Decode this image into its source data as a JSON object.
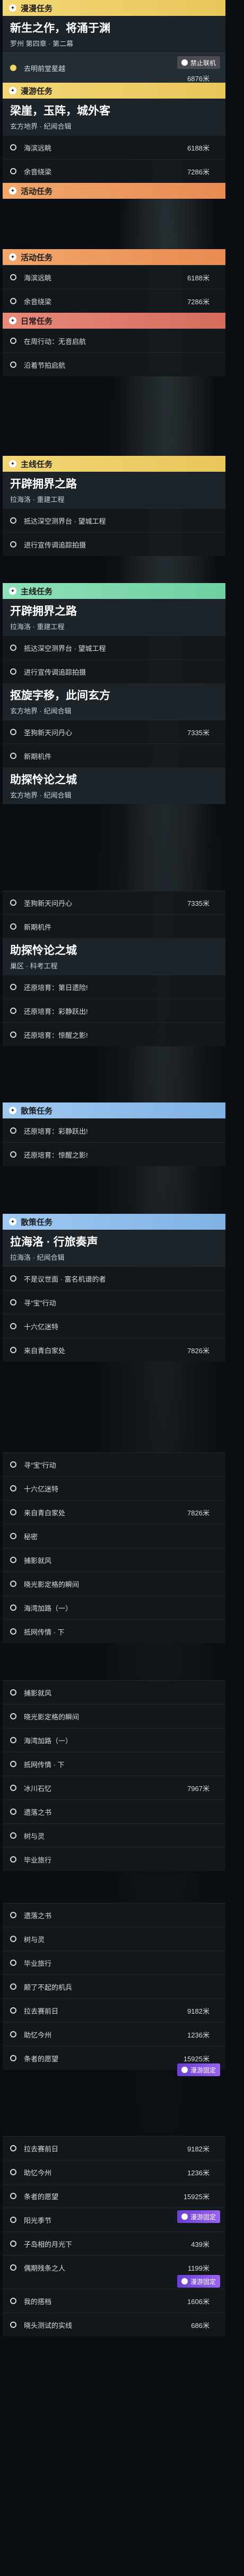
{
  "labels": {
    "cat_permanent": "漫漫任务",
    "cat_seasonal": "漫游任务",
    "cat_active": "活动任务",
    "cat_side": "日常任务",
    "cat_main": "主线任务",
    "cat_trail": "散策任务"
  },
  "quests": {
    "q1_title": "新生之作，将涌于渊",
    "q1_sub": "罗州 第四章 · 第二幕",
    "q2_title": "梁崖，玉阵，城外客",
    "q2_sub": "玄方地界 · 纪闻合辑",
    "q3_title": "开辟拥界之路",
    "q3_sub": "拉海洛 · 重建工程",
    "q4_title": "抠旋字移，此间玄方",
    "q4_sub": "玄方地界 · 纪闻合辑",
    "q5_title": "助探怜论之城",
    "q5_sub": "巢区 · 科考工程",
    "q6_title": "拉海洛 · 行旅奏声",
    "q6_sub": "拉海洛 · 纪闻合辑"
  },
  "rows": {
    "r_seek_star": "去明前堂星越",
    "r_seek_dist": "6876米",
    "r_pearl_photo": "海滨远眺",
    "r_pearl_dist": "6188米",
    "r_fire": "余音绕梁",
    "r_fire_dist": "7286米",
    "r_pearl2": "海滨远眺",
    "r_pearl2_dist": "6188米",
    "r_fire2": "余音绕梁",
    "r_fire2_dist": "7286米",
    "r_act1": "在周行动：无音启航",
    "r_act2": "沿着节拍启航",
    "r_build1": "抵达深空测界台 · 望城工程",
    "r_build2": "进行宣传调追踪拍摄",
    "r_build3": "抵达深空测界台 · 望城工程",
    "r_build4": "进行宣传调追踪拍摄",
    "r_hub": "圣狗新天问丹心",
    "r_hub_dist": "7335米",
    "r_mecha": "新期机件",
    "r_hub2": "圣狗新天问丹心",
    "r_hub2_dist": "7335米",
    "r_mecha2": "新期机件",
    "r_tour1": "还原培育：第日遗险!",
    "r_tour2": "还原培育：彩静跃出!",
    "r_tour3": "还原培育：惊醒之影!",
    "r_tour4": "还原培育：彩静跃出!",
    "r_tour5": "还原培育：惊醒之影!",
    "r_wander1": "不是议世面 · 富名机谱的者",
    "r_wander2": "寻“宝”行动",
    "r_wander3": "十六亿迷特",
    "r_wander4": "来自青白家处",
    "r_wander4_dist": "7826米",
    "r_wander5": "秘密",
    "r_wander6": "捕影就风",
    "r_wander7": "晓光影定格的瞬间",
    "r_wander8": "海湾加路（一）",
    "r_wander9": "抵网传情 · 下",
    "r_wander10": "冰川石忆",
    "r_wander10_dist": "7967米",
    "r_wander11": "遗落之书",
    "r_wander12": "树与灵",
    "r_wander13": "毕业旅行",
    "r_wander14": "颠了不起的机兵",
    "r_wander15": "拉去赛前日",
    "r_wander15_dist": "9182米",
    "r_wander16": "助忆今州",
    "r_wander16_dist": "1236米",
    "r_wander17": "条者的愿望",
    "r_wander17_dist": "15925米",
    "r_wander18": "阳光季节",
    "r_wander19": "子岛相的月光下",
    "r_wander19_dist": "439米",
    "r_wander20": "偶期残条之人",
    "r_wander20_dist": "1199米",
    "r_wander21": "我的搭档",
    "r_wander21_dist": "1606米",
    "r_wander22": "晓头测试的实线",
    "r_wander22_dist": "686米"
  },
  "tags": {
    "lock": "禁止联机",
    "fixed": "漫游固定"
  },
  "colors": {
    "yellow": "#e8c65a",
    "orange": "#e88b53",
    "red": "#d56c5e",
    "green": "#6fcfa3",
    "blue": "#7fb2e4",
    "purple": "#8a55e8"
  }
}
